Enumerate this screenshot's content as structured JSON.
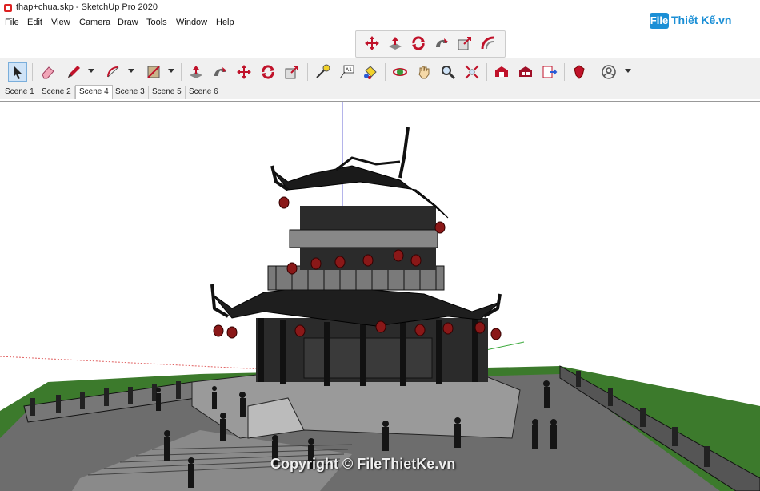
{
  "window": {
    "title": "thap+chua.skp - SketchUp Pro 2020"
  },
  "menu": [
    "File",
    "Edit",
    "View",
    "Camera",
    "Draw",
    "Tools",
    "Window",
    "Help"
  ],
  "watermark": {
    "logo_box": "File",
    "logo_text": "Thiết Kế.vn"
  },
  "toolbar_top": [
    "move-icon",
    "push-pull-icon",
    "rotate-icon",
    "follow-me-icon",
    "scale-icon",
    "offset-icon"
  ],
  "toolbar_main": [
    "select-icon",
    "eraser-icon",
    "pencil-icon",
    "arc-icon",
    "rectangle-icon",
    "push-pull-icon",
    "follow-me-icon",
    "move-icon",
    "rotate-icon",
    "scale-icon",
    "tape-measure-icon",
    "text-icon",
    "paint-bucket-icon",
    "orbit-icon",
    "pan-icon",
    "zoom-icon",
    "zoom-extents-icon",
    "warehouse-icon",
    "extension-warehouse-icon",
    "send-to-layout-icon",
    "ruby-icon",
    "account-icon"
  ],
  "scenes": [
    "Scene 1",
    "Scene 2",
    "Scene 4",
    "Scene 3",
    "Scene 5",
    "Scene 6"
  ],
  "active_scene": "Scene 4",
  "viewport": {
    "copyright": "Copyright © FileThietKe.vn"
  }
}
